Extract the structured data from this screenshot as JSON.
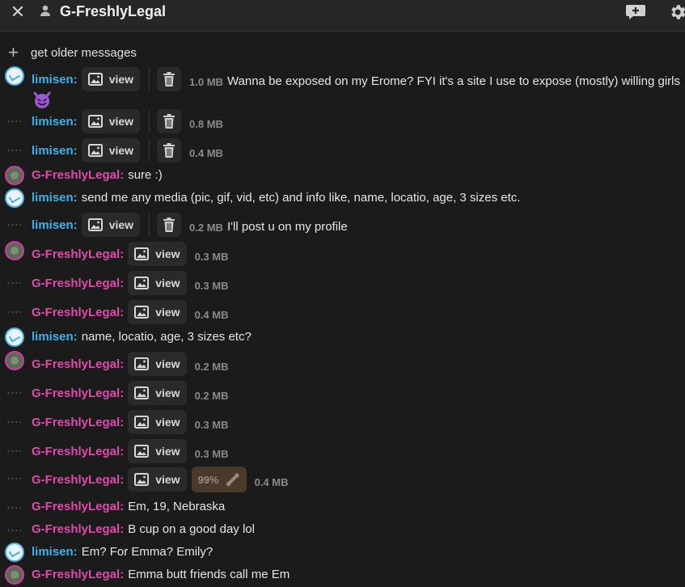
{
  "header": {
    "title": "G-FreshlyLegal",
    "icons": {
      "close": "close-icon",
      "user": "user-icon",
      "chat": "chat-add-icon",
      "settings": "gear-icon"
    }
  },
  "older_messages_label": "get older messages",
  "colors": {
    "limisen": "#3fb1e8",
    "freshly": "#e04aac",
    "background": "#1b1b1b"
  },
  "nicks": {
    "limisen": "limisen:",
    "freshly": "G-FreshlyLegal:"
  },
  "media_label": "view",
  "messages": [
    {
      "sender": "limisen",
      "type": "media",
      "size": "1.0 MB",
      "text": "Wanna be exposed on my Erome? FYI it's a site I use to expose (mostly) willing girls",
      "emoji": "😈"
    },
    {
      "sender": "limisen",
      "type": "media",
      "size": "0.8 MB"
    },
    {
      "sender": "limisen",
      "type": "media",
      "size": "0.4 MB"
    },
    {
      "sender": "freshly",
      "type": "text",
      "text": "sure :)"
    },
    {
      "sender": "limisen",
      "type": "text",
      "text": "send me any media (pic, gif, vid, etc) and info like, name, locatio, age, 3 sizes etc."
    },
    {
      "sender": "limisen",
      "type": "media",
      "size": "0.2 MB",
      "text": "I'll post u on my profile"
    },
    {
      "sender": "freshly",
      "type": "media",
      "size": "0.3 MB"
    },
    {
      "sender": "freshly",
      "type": "media",
      "size": "0.3 MB"
    },
    {
      "sender": "freshly",
      "type": "media",
      "size": "0.4 MB"
    },
    {
      "sender": "limisen",
      "type": "text",
      "text": "name, locatio, age, 3 sizes etc?"
    },
    {
      "sender": "freshly",
      "type": "media",
      "size": "0.2 MB"
    },
    {
      "sender": "freshly",
      "type": "media",
      "size": "0.2 MB"
    },
    {
      "sender": "freshly",
      "type": "media",
      "size": "0.3 MB"
    },
    {
      "sender": "freshly",
      "type": "media",
      "size": "0.3 MB"
    },
    {
      "sender": "freshly",
      "type": "media",
      "size": "0.4 MB",
      "progress": "99%"
    },
    {
      "sender": "freshly",
      "type": "text",
      "text": "Em, 19, Nebraska"
    },
    {
      "sender": "freshly",
      "type": "text",
      "text": "B cup on a good day lol"
    },
    {
      "sender": "limisen",
      "type": "text",
      "text": "Em? For Emma? Emily?"
    },
    {
      "sender": "freshly",
      "type": "text",
      "text": "Emma butt friends call me Em"
    }
  ]
}
